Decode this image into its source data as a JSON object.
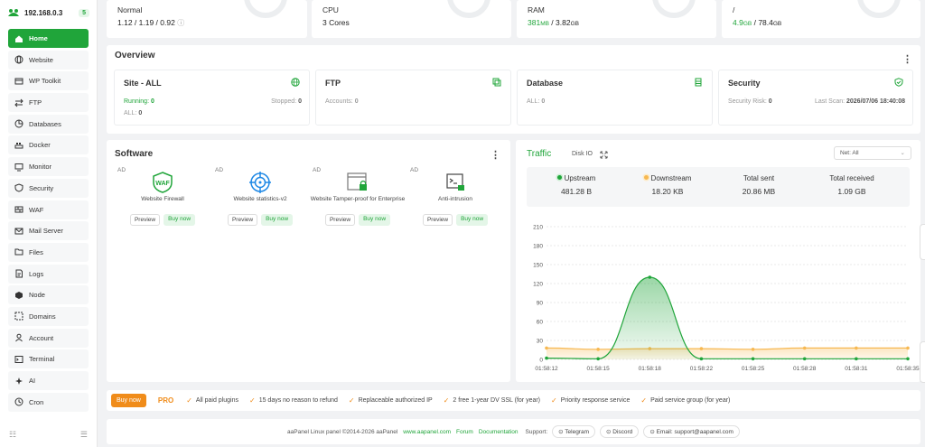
{
  "sidebar": {
    "ip": "192.168.0.3",
    "badge": "5",
    "items": [
      {
        "label": "Home",
        "icon": "home-icon",
        "active": true
      },
      {
        "label": "Website",
        "icon": "globe-icon"
      },
      {
        "label": "WP Toolkit",
        "icon": "wp-toolkit-icon"
      },
      {
        "label": "FTP",
        "icon": "transfer-icon"
      },
      {
        "label": "Databases",
        "icon": "pie-icon"
      },
      {
        "label": "Docker",
        "icon": "docker-icon"
      },
      {
        "label": "Monitor",
        "icon": "monitor-icon"
      },
      {
        "label": "Security",
        "icon": "shield-icon"
      },
      {
        "label": "WAF",
        "icon": "waf-icon"
      },
      {
        "label": "Mail Server",
        "icon": "mail-icon"
      },
      {
        "label": "Files",
        "icon": "folder-icon"
      },
      {
        "label": "Logs",
        "icon": "log-icon"
      },
      {
        "label": "Node",
        "icon": "node-icon"
      },
      {
        "label": "Domains",
        "icon": "domain-icon"
      },
      {
        "label": "Account",
        "icon": "user-icon"
      },
      {
        "label": "Terminal",
        "icon": "terminal-icon"
      },
      {
        "label": "AI",
        "icon": "ai-icon"
      },
      {
        "label": "Cron",
        "icon": "clock-icon"
      }
    ]
  },
  "stats": {
    "load": {
      "label": "Normal",
      "value": "1.12 / 1.19 / 0.92"
    },
    "cpu": {
      "label": "CPU",
      "value": "3 Cores"
    },
    "ram": {
      "label": "RAM",
      "used": "381",
      "used_unit": "MB",
      "sep": " / ",
      "total": "3.82",
      "total_unit": "GB"
    },
    "disk": {
      "label": "/",
      "used": "4.9",
      "used_unit": "GB",
      "sep": " / ",
      "total": "78.4",
      "total_unit": "GB"
    }
  },
  "overview": {
    "title": "Overview",
    "site": {
      "title": "Site - ALL",
      "running_label": "Running:",
      "running": "0",
      "stopped_label": "Stopped:",
      "stopped": "0",
      "all_label": "ALL:",
      "all": "0"
    },
    "ftp": {
      "title": "FTP",
      "accounts_label": "Accounts:",
      "accounts": "0"
    },
    "database": {
      "title": "Database",
      "all_label": "ALL:",
      "all": "0"
    },
    "security": {
      "title": "Security",
      "risk_label": "Security Risk:",
      "risk": "0",
      "scan_label": "Last Scan:",
      "scan": "2026/07/06 18:40:08"
    }
  },
  "software": {
    "title": "Software",
    "items": [
      {
        "ad": "AD",
        "name": "Website Firewall",
        "preview": "Preview",
        "buy": "Buy now",
        "icon": "waf-shield-icon"
      },
      {
        "ad": "AD",
        "name": "Website statistics-v2",
        "preview": "Preview",
        "buy": "Buy now",
        "icon": "crosshair-icon"
      },
      {
        "ad": "AD",
        "name": "Website Tamper-proof for Enterprise",
        "preview": "Preview",
        "buy": "Buy now",
        "icon": "lock-window-icon"
      },
      {
        "ad": "AD",
        "name": "Anti-intrusion",
        "preview": "Preview",
        "buy": "Buy now",
        "icon": "terminal-lock-icon"
      }
    ]
  },
  "traffic": {
    "title": "Traffic",
    "tab2": "Disk IO",
    "select": "Net: All",
    "upstream_label": "Upstream",
    "upstream": "481.28 B",
    "downstream_label": "Downstream",
    "downstream": "18.20 KB",
    "sent_label": "Total sent",
    "sent": "20.86 MB",
    "received_label": "Total received",
    "received": "1.09 GB",
    "colors": {
      "upstream": "#20a53a",
      "downstream": "#f7b851"
    }
  },
  "chart_data": {
    "type": "line",
    "x": [
      "01:58:12",
      "01:58:15",
      "01:58:18",
      "01:58:22",
      "01:58:25",
      "01:58:28",
      "01:58:31",
      "01:58:35"
    ],
    "yticks": [
      0,
      30,
      60,
      90,
      120,
      150,
      180,
      210
    ],
    "ylim": [
      0,
      210
    ],
    "grid": true,
    "series": [
      {
        "name": "Upstream",
        "color": "#20a53a",
        "values": [
          2,
          1,
          130,
          1,
          1,
          1,
          1,
          1
        ]
      },
      {
        "name": "Downstream",
        "color": "#f7b851",
        "values": [
          18,
          16,
          17,
          17,
          16,
          18,
          18,
          18
        ]
      }
    ]
  },
  "pro_bar": {
    "buy": "Buy now",
    "tag": "PRO",
    "features": [
      "All paid plugins",
      "15 days no reason to refund",
      "Replaceable authorized IP",
      "2 free 1-year DV SSL (for year)",
      "Priority response service",
      "Paid service group (for year)"
    ]
  },
  "footer": {
    "copyright": "aaPanel Linux panel ©2014-2026 aaPanel",
    "site": "www.aapanel.com",
    "forum": "Forum",
    "docs": "Documentation",
    "support": "Support:",
    "telegram": "Telegram",
    "discord": "Discord",
    "email": "Email: support@aapanel.com"
  }
}
